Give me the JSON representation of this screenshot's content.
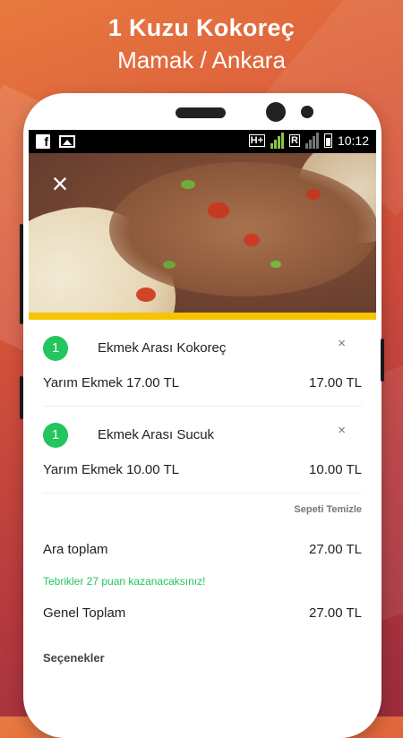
{
  "promo": {
    "title": "1 Kuzu Kokoreç",
    "subtitle": "Mamak / Ankara"
  },
  "status_bar": {
    "network_1": "H+",
    "network_2": "R",
    "network_2_sim": "2",
    "time": "10:12"
  },
  "hero": {
    "close_icon": "×"
  },
  "cart": {
    "items": [
      {
        "qty": "1",
        "name": "Ekmek Arası Kokoreç",
        "remove": "×",
        "option": "Yarım Ekmek 17.00 TL",
        "price": "17.00 TL"
      },
      {
        "qty": "1",
        "name": "Ekmek Arası Sucuk",
        "remove": "×",
        "option": "Yarım Ekmek 10.00 TL",
        "price": "10.00 TL"
      }
    ],
    "clear_label": "Sepeti Temizle",
    "subtotal_label": "Ara toplam",
    "subtotal_value": "27.00 TL",
    "points_message": "Tebrikler 27 puan kazanacaksınız!",
    "total_label": "Genel Toplam",
    "total_value": "27.00 TL",
    "options_title": "Seçenekler"
  },
  "colors": {
    "accent_green": "#23c55e",
    "accent_yellow": "#f6c400"
  }
}
